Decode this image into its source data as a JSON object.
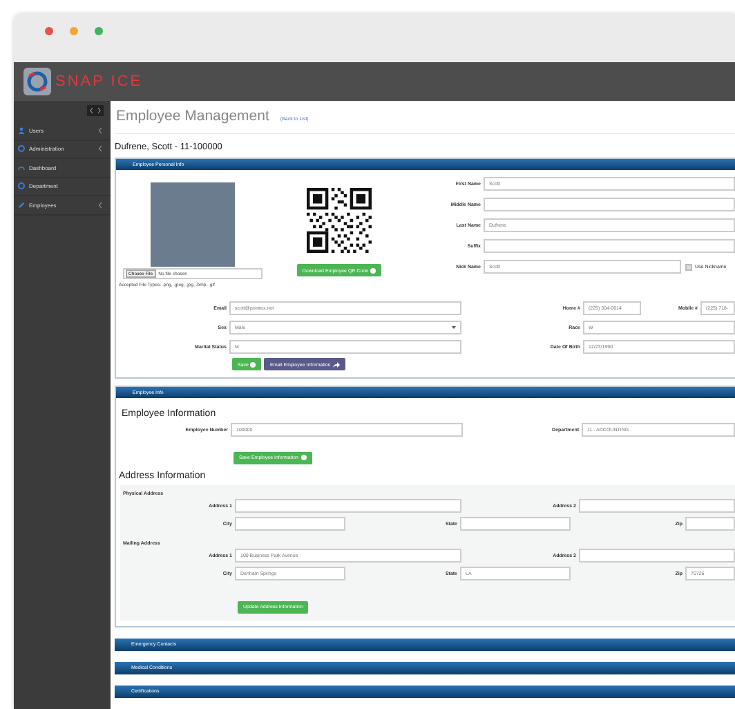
{
  "app": {
    "logo": "SNAP ICE"
  },
  "sidebar": {
    "items": [
      {
        "label": "Users",
        "kind": "person",
        "expandable": true
      },
      {
        "label": "Administration",
        "kind": "gear",
        "expandable": true
      },
      {
        "label": "Dashboard",
        "kind": "gauge",
        "expandable": false
      },
      {
        "label": "Department",
        "kind": "gear",
        "expandable": false
      },
      {
        "label": "Employees",
        "kind": "pencil",
        "expandable": true
      }
    ]
  },
  "page": {
    "title": "Employee Management",
    "back_link": "(Back to List)",
    "employee_heading": "Dufrene, Scott - 11-100000"
  },
  "personal": {
    "title": "Employee Personal Info",
    "file": {
      "button": "Choose File",
      "status": "No file chosen"
    },
    "accepted": "Accepted File Types: .png, .jpeg, .jpg, .bmp, .gif",
    "qr_button": "Download Employee QR Code",
    "name_fields": [
      {
        "label": "First Name",
        "value": "Scott"
      },
      {
        "label": "Middle Name"
      },
      {
        "label": "Last Name",
        "value": "Dufrene"
      },
      {
        "label": "Suffix"
      }
    ],
    "nickname": {
      "label": "Nick Name",
      "value": "Scott",
      "checkbox": {
        "label": "Use Nickname",
        "checked": false
      }
    },
    "rows": [
      [
        {
          "label": "Email",
          "value": "scott@pointex.net",
          "kind": "text"
        },
        {
          "label": "Home #",
          "value": "(225) 304-0614",
          "kind": "text"
        },
        {
          "label": "Mobile #",
          "value": "(225) 718-",
          "kind": "text"
        }
      ],
      [
        {
          "label": "Sex",
          "value": "Male",
          "kind": "select"
        },
        {
          "label": "Race",
          "value": "W",
          "kind": "text"
        }
      ],
      [
        {
          "label": "Marital Status",
          "value": "M",
          "kind": "text"
        },
        {
          "label": "Date Of Birth",
          "value": "12/23/1990",
          "kind": "text"
        }
      ]
    ],
    "buttons": [
      {
        "label": "Save",
        "kind": "success"
      },
      {
        "label": "Email Employee Information",
        "kind": "info"
      }
    ]
  },
  "employee_info": {
    "title": "Employee Info",
    "heading": "Employee Information",
    "fields": [
      {
        "label": "Employee Number",
        "value": "100000"
      },
      {
        "label": "Department",
        "value": "11 - ACCOUNTING"
      }
    ],
    "button": "Save Employee Information",
    "address_heading": "Address Information",
    "addresses": [
      {
        "title": "Physical Address",
        "line_fields": [
          {
            "label": "Address 1"
          },
          {
            "label": "Address 2"
          }
        ],
        "city_fields": [
          {
            "label": "City"
          },
          {
            "label": "State"
          },
          {
            "label": "Zip"
          }
        ]
      },
      {
        "title": "Mailing Address",
        "line_fields": [
          {
            "label": "Address 1",
            "value": "100 Business Park Avenue"
          },
          {
            "label": "Address 2"
          }
        ],
        "city_fields": [
          {
            "label": "City",
            "value": "Denham Springs"
          },
          {
            "label": "State",
            "value": "LA"
          },
          {
            "label": "Zip",
            "value": "70726"
          }
        ]
      }
    ],
    "address_button": "Update Address Information"
  },
  "collapsed_panels": [
    "Emergency Contacts",
    "Medical Conditions",
    "Certifications"
  ]
}
